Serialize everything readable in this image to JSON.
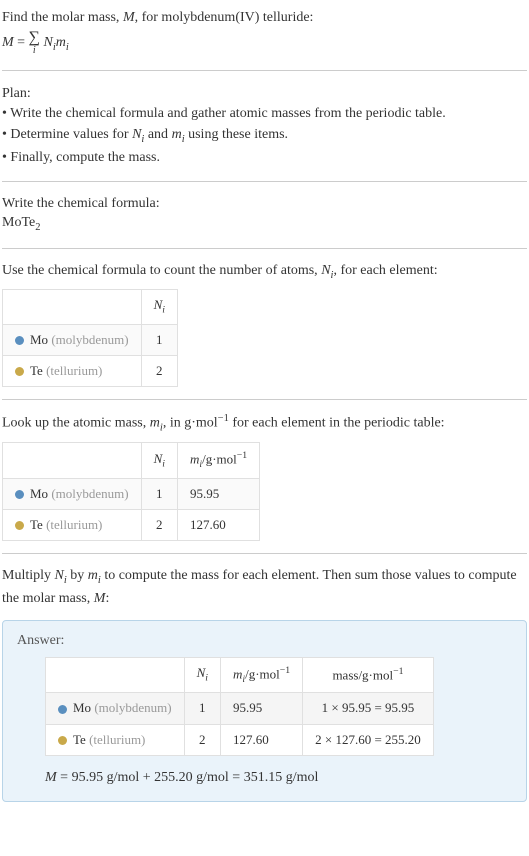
{
  "intro": {
    "line1_pre": "Find the molar mass, ",
    "line1_var": "M",
    "line1_post": ", for molybdenum(IV) telluride:",
    "eq_lhs": "M",
    "eq_eq": " = ",
    "eq_sigma": "∑",
    "eq_idx": "i",
    "eq_rhs_a": "N",
    "eq_rhs_b": "m"
  },
  "plan": {
    "title": "Plan:",
    "items": [
      "• Write the chemical formula and gather atomic masses from the periodic table.",
      "• Determine values for N_i and m_i using these items.",
      "• Finally, compute the mass."
    ],
    "item2_pre": "• Determine values for ",
    "item2_n": "N",
    "item2_and": " and ",
    "item2_m": "m",
    "item2_post": " using these items."
  },
  "formula_section": {
    "title": "Write the chemical formula:",
    "formula": "MoTe",
    "sub": "2"
  },
  "count_section": {
    "title_pre": "Use the chemical formula to count the number of atoms, ",
    "title_var": "N",
    "title_post": ", for each element:",
    "header_n": "N",
    "header_i": "i",
    "rows": [
      {
        "color": "#5a8fbf",
        "sym": "Mo",
        "name": "(molybdenum)",
        "n": "1"
      },
      {
        "color": "#c9a94a",
        "sym": "Te",
        "name": "(tellurium)",
        "n": "2"
      }
    ]
  },
  "mass_section": {
    "title_pre": "Look up the atomic mass, ",
    "title_var": "m",
    "title_mid": ", in g·mol",
    "title_exp": "−1",
    "title_post": " for each element in the periodic table:",
    "header_m": "m",
    "header_unit_pre": "/g·mol",
    "rows": [
      {
        "color": "#5a8fbf",
        "sym": "Mo",
        "name": "(molybdenum)",
        "n": "1",
        "m": "95.95"
      },
      {
        "color": "#c9a94a",
        "sym": "Te",
        "name": "(tellurium)",
        "n": "2",
        "m": "127.60"
      }
    ]
  },
  "multiply_section": {
    "text_pre": "Multiply ",
    "text_by": " by ",
    "text_post": " to compute the mass for each element. Then sum those values to compute the molar mass, ",
    "text_end": ":"
  },
  "answer": {
    "label": "Answer:",
    "header_mass": "mass/g·mol",
    "rows": [
      {
        "color": "#5a8fbf",
        "sym": "Mo",
        "name": "(molybdenum)",
        "n": "1",
        "m": "95.95",
        "calc": "1 × 95.95 = 95.95"
      },
      {
        "color": "#c9a94a",
        "sym": "Te",
        "name": "(tellurium)",
        "n": "2",
        "m": "127.60",
        "calc": "2 × 127.60 = 255.20"
      }
    ],
    "final_pre": "M",
    "final": " = 95.95 g/mol + 255.20 g/mol = 351.15 g/mol"
  }
}
